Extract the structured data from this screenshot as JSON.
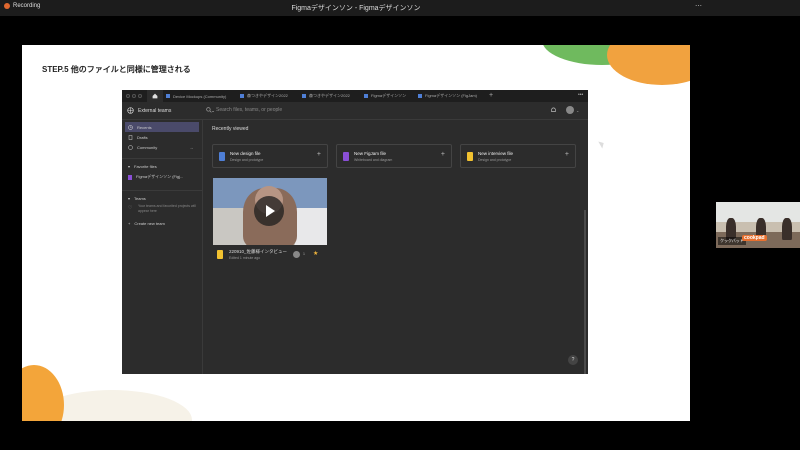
{
  "app": {
    "window_title": "Figmaデザインソン - Figmaデザインソン",
    "recording_label": "Recording"
  },
  "slide": {
    "title": "STEP.5 他のファイルと同様に管理される"
  },
  "figma": {
    "tabs": [
      {
        "label": "Device Mockups (Community)"
      },
      {
        "label": "森つきやデザイン2022"
      },
      {
        "label": "森つきやデザイン2022"
      },
      {
        "label": "Figmaデザインソン"
      },
      {
        "label": "Figmaデザインソン (FigJam)"
      }
    ],
    "team_name": "External teams",
    "search_placeholder": "Search files, teams, or people",
    "sidebar": {
      "items": [
        {
          "label": "Recents"
        },
        {
          "label": "Drafts"
        },
        {
          "label": "Community"
        }
      ],
      "favorites_title": "Favorite files",
      "favorites": [
        {
          "label": "Figmaデザインソン (Figj..."
        }
      ],
      "teams_title": "Teams",
      "teams_note": "Your teams and favorited projects will appear here",
      "create_team": "Create new team"
    },
    "main": {
      "section_title": "Recently viewed",
      "cards": [
        {
          "title": "New design file",
          "subtitle": "Design and prototype",
          "color": "#4f7fd6"
        },
        {
          "title": "New FigJam file",
          "subtitle": "Whiteboard and diagram",
          "color": "#8a4fd6"
        },
        {
          "title": "New interview file",
          "subtitle": "Design and prototype",
          "color": "#f2c230"
        }
      ],
      "file": {
        "name": "220910_佐藤様インタビュー",
        "meta": "Edited 1 minute ago",
        "count": "1"
      }
    },
    "help_label": "?"
  },
  "webcam": {
    "name_label": "クックパッド",
    "logo_label": "cookpad"
  }
}
